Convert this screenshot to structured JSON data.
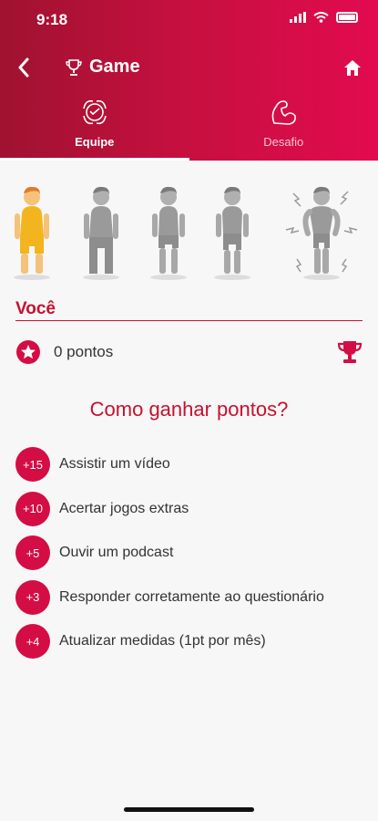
{
  "status_bar": {
    "time": "9:18"
  },
  "nav": {
    "title": "Game",
    "back_icon": "chevron-left-icon",
    "home_icon": "home-icon",
    "title_icon": "trophy-icon"
  },
  "tabs": [
    {
      "label": "Equipe",
      "icon": "team-hands-icon",
      "active": true
    },
    {
      "label": "Desafio",
      "icon": "flexed-arm-icon",
      "active": false
    }
  ],
  "avatars": [
    {
      "stage": 1,
      "state": "current",
      "color": "#f3b51f"
    },
    {
      "stage": 2,
      "state": "locked",
      "color": "#9a9a9a"
    },
    {
      "stage": 3,
      "state": "locked",
      "color": "#9a9a9a"
    },
    {
      "stage": 4,
      "state": "locked",
      "color": "#9a9a9a"
    },
    {
      "stage": 5,
      "state": "locked",
      "color": "#9a9a9a"
    }
  ],
  "user": {
    "label": "Você",
    "points_text": "0 pontos"
  },
  "how_to": {
    "title": "Como ganhar pontos?",
    "rules": [
      {
        "points": "+15",
        "label": "Assistir um vídeo"
      },
      {
        "points": "+10",
        "label": "Acertar jogos extras"
      },
      {
        "points": "+5",
        "label": "Ouvir um podcast"
      },
      {
        "points": "+3",
        "label": "Responder corretamente ao questionário"
      },
      {
        "points": "+4",
        "label": "Atualizar medidas (1pt por mês)"
      }
    ]
  },
  "colors": {
    "accent": "#c8102e",
    "badge": "#d40d45",
    "header_start": "#9f1230",
    "header_end": "#e20b4f"
  }
}
